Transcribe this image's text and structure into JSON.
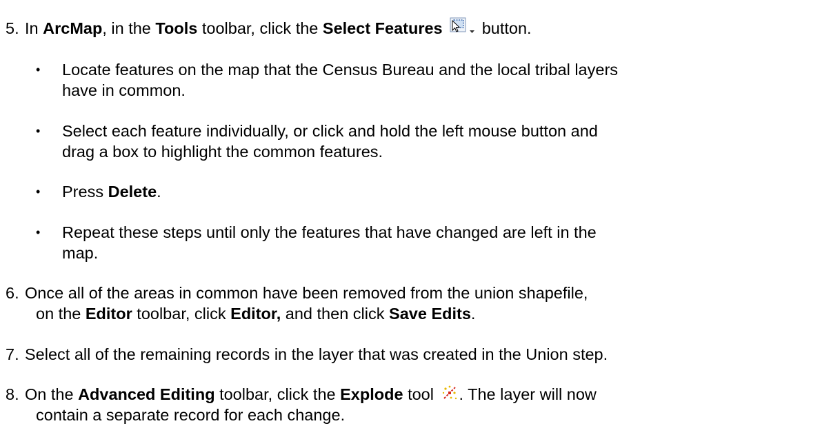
{
  "steps": [
    {
      "number": "5.",
      "text": {
        "in": "In ",
        "arcmap": "ArcMap",
        "in_the": ", in the ",
        "tools": "Tools",
        "toolbar_click": " toolbar, click the ",
        "select_features": "Select Features",
        "button": " button."
      },
      "icons": [
        "select-features-icon",
        "dropdown-arrow-icon"
      ],
      "bullets": [
        {
          "lines": [
            "Locate features on the map that the Census Bureau and the local tribal layers",
            "have in common."
          ]
        },
        {
          "lines": [
            "Select each feature individually,  or click and hold the left mouse button and",
            "drag a box to highlight  the common features."
          ]
        },
        {
          "pre": "Press ",
          "bold": "Delete",
          "post": "."
        },
        {
          "lines": [
            "Repeat these steps until only the features that have changed are left in the",
            "map."
          ]
        }
      ]
    },
    {
      "number": "6.",
      "line1": "Once all of the areas in common have been removed from the union shapefile,",
      "line2": {
        "a": "on the ",
        "editor_toolbar": "Editor",
        "b": " toolbar,  click ",
        "editor": "Editor,",
        "c": " and then click ",
        "save_edits": "Save Edits",
        "d": "."
      }
    },
    {
      "number": "7.",
      "text": "Select all of the remaining records in the layer that was created in the Union step."
    },
    {
      "number": "8.",
      "line1": {
        "a": "On the ",
        "advanced_editing": "Advanced Editing",
        "b": " toolbar, click the ",
        "explode": "Explode",
        "c": " tool ",
        "d": ". The layer will now"
      },
      "line2": "contain a separate record for each change.",
      "icons": [
        "explode-icon"
      ]
    }
  ],
  "bullet_symbol": "•"
}
